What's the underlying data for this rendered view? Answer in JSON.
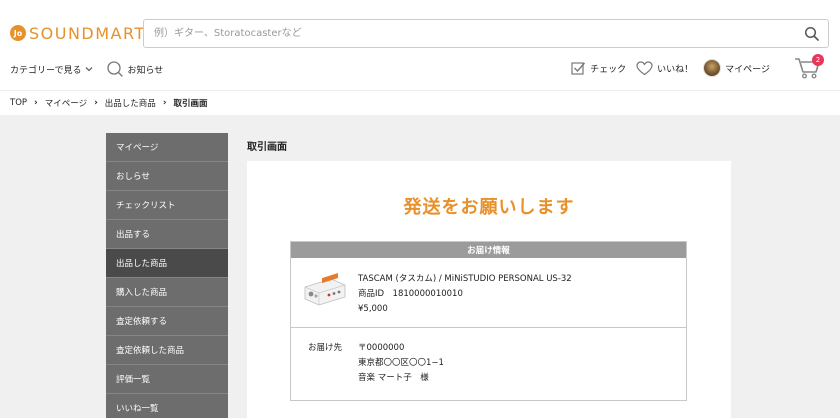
{
  "header": {
    "logo_mark": "Jo",
    "logo_text": "SOUNDMART",
    "search_placeholder": "例）ギター、Storatocasterなど"
  },
  "nav": {
    "category": "カテゴリーで見る",
    "notifications": "お知らせ",
    "check": "チェック",
    "like": "いいね！",
    "mypage": "マイページ",
    "cart_count": "2"
  },
  "breadcrumb": [
    "TOP",
    "マイページ",
    "出品した商品",
    "取引画面"
  ],
  "sidebar": {
    "items": [
      {
        "label": "マイページ",
        "active": false
      },
      {
        "label": "おしらせ",
        "active": false
      },
      {
        "label": "チェックリスト",
        "active": false
      },
      {
        "label": "出品する",
        "active": false
      },
      {
        "label": "出品した商品",
        "active": true
      },
      {
        "label": "購入した商品",
        "active": false
      },
      {
        "label": "査定依頼する",
        "active": false
      },
      {
        "label": "査定依頼した商品",
        "active": false
      },
      {
        "label": "評価一覧",
        "active": false
      },
      {
        "label": "いいね一覧",
        "active": false
      }
    ]
  },
  "main": {
    "title": "取引画面",
    "heading": "発送をお願いします",
    "delivery": {
      "header": "お届け情報",
      "product_name": "TASCAM (タスカム) / MiNiSTUDIO PERSONAL US-32",
      "product_id": "商品ID　1810000010010",
      "price": "¥5,000",
      "address_label": "お届け先",
      "postal": "〒0000000",
      "address": "東京都〇〇区〇〇1−1",
      "recipient": "音楽 マート子　様"
    }
  },
  "colors": {
    "accent": "#e8902a",
    "sidebar_bg": "#6d6d6d",
    "sidebar_active": "#4a4a4a",
    "badge": "#e8375a"
  }
}
